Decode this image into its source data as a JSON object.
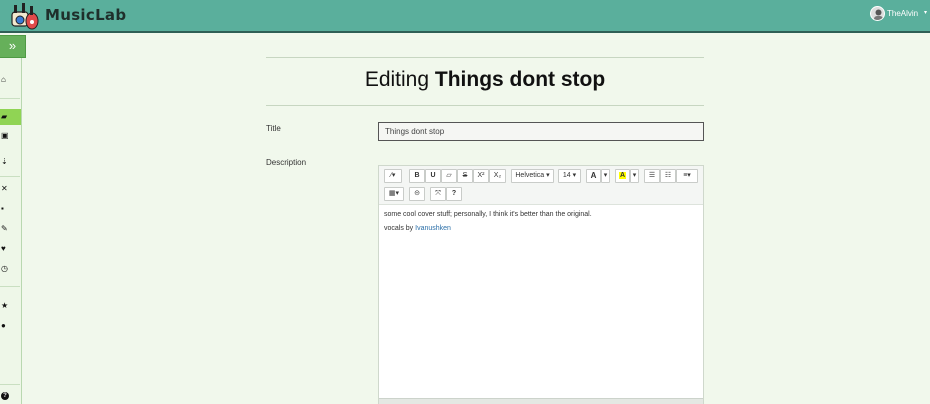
{
  "app": {
    "brand": "MusicLab",
    "colors": {
      "topbar": "#5aaf9c",
      "sidebar_active": "#90d454",
      "accent_link": "#2b6fa8"
    }
  },
  "user": {
    "name": "TheAlvin",
    "caret": "▾"
  },
  "sidebar": {
    "toggle": "»",
    "items": [
      {
        "icon": "home-icon",
        "glyph": "⌂"
      },
      {
        "icon": "folder-open-icon",
        "glyph": "▰"
      },
      {
        "icon": "plus-square-icon",
        "glyph": "▣"
      },
      {
        "icon": "sort-numeric-icon",
        "glyph": "⇣"
      },
      {
        "icon": "close-icon",
        "glyph": "✕"
      },
      {
        "icon": "lock-icon",
        "glyph": "▪"
      },
      {
        "icon": "pencil-icon",
        "glyph": "✎"
      },
      {
        "icon": "heart-icon",
        "glyph": "♥"
      },
      {
        "icon": "clock-icon",
        "glyph": "◷"
      },
      {
        "icon": "star-icon",
        "glyph": "★"
      },
      {
        "icon": "comment-icon",
        "glyph": "●"
      },
      {
        "icon": "help-icon",
        "glyph": "?"
      }
    ]
  },
  "page": {
    "title_prefix": "Editing",
    "title_name": "Things dont stop",
    "title_label": "Title",
    "title_value": "Things dont stop",
    "description_label": "Description"
  },
  "editor": {
    "toolbar": {
      "magic": "⁄▾",
      "bold": "B",
      "underline": "U",
      "eraser": "▱",
      "strike": "S",
      "superscript": "X²",
      "subscript": "X₂",
      "font": "Helvetica ▾",
      "size": "14 ▾",
      "color_letter": "A",
      "color_caret": "▾",
      "highlight_letter": "A",
      "highlight_caret": "▾",
      "ul": "☰",
      "ol": "☷",
      "align": "≡▾",
      "table": "▦▾",
      "link": "⊝",
      "fullscreen": "⤧",
      "help": "?"
    },
    "body_line1": "some cool cover stuff; personally, I think it's better than the original.",
    "body_line2_prefix": "vocals by",
    "body_link": "Ivanushken"
  }
}
